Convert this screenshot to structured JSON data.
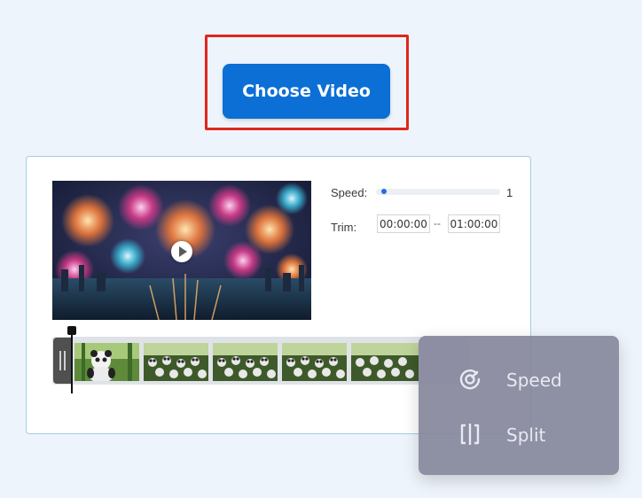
{
  "toolbar": {
    "choose_video_label": "Choose Video"
  },
  "editor": {
    "speed_label": "Speed:",
    "speed_value": "1",
    "speed_level": 0.02,
    "trim_label": "Trim:",
    "trim_start": "00:00:00",
    "trim_separator": "--",
    "trim_end": "01:00:00",
    "preview_icon": "play-icon"
  },
  "context_menu": {
    "items": [
      {
        "label": "Speed",
        "icon": "speedometer-icon"
      },
      {
        "label": "Split",
        "icon": "split-icon"
      }
    ]
  },
  "colors": {
    "accent": "#0b6fd6",
    "highlight": "#e0261b",
    "background": "#eef4fb",
    "menu": "#86879c"
  }
}
